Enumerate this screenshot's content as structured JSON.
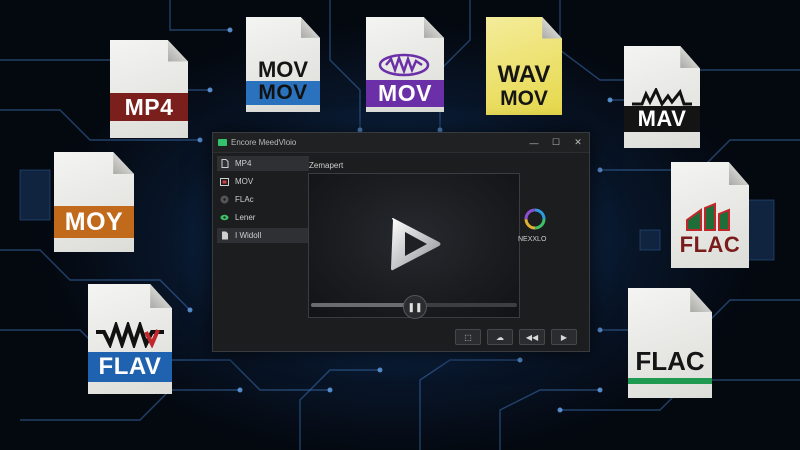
{
  "window": {
    "title": "Encore MeedVloio",
    "controls": [
      "—",
      "☐",
      "✕"
    ]
  },
  "sidebar": {
    "items": [
      {
        "label": "MP4",
        "icon": "file-icon"
      },
      {
        "label": "MOV",
        "icon": "film-icon"
      },
      {
        "label": "FLAc",
        "icon": "disc-icon"
      },
      {
        "label": "Lener",
        "icon": "eye-icon"
      },
      {
        "label": "I Widoll",
        "icon": "document-icon"
      }
    ]
  },
  "player": {
    "panel_label": "Zemapert",
    "progress": 0.47,
    "loader_text": "NEXXLO"
  },
  "toolbar": {
    "buttons": [
      "import-button",
      "cloud-button",
      "rewind-button",
      "play-button"
    ]
  },
  "files": [
    {
      "label": "MP4",
      "color": "#7a1f1c"
    },
    {
      "label": "MOV",
      "label2": "MOV",
      "color": "#2a72bd"
    },
    {
      "label": "MOV",
      "color": "#6b2fa8"
    },
    {
      "label": "WAV",
      "label2": "MOV",
      "color": "#d8c61a"
    },
    {
      "label": "MAV",
      "color": "#141414"
    },
    {
      "label": "MOY",
      "color": "#c26a1c"
    },
    {
      "label": "FLAC",
      "color": "#7a1c1c"
    },
    {
      "label": "FLAV",
      "color": "#1f63b0"
    },
    {
      "label": "FLAC",
      "color": "#1f9a50"
    }
  ]
}
